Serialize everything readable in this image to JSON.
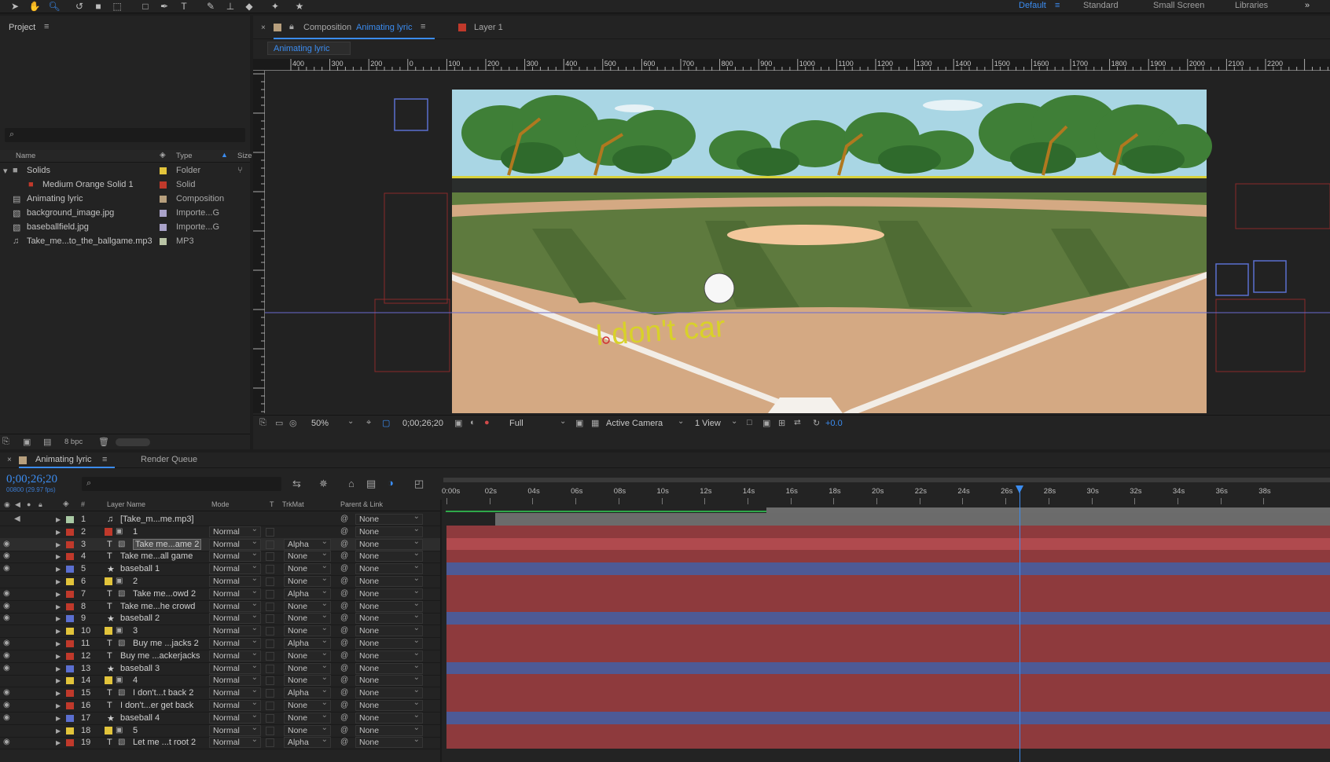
{
  "toolbar": {
    "tools": [
      "selection-tool",
      "hand-tool",
      "zoom-tool",
      "rotate-tool",
      "camera-tool",
      "pan-behind-tool",
      "rectangle-tool",
      "pen-tool",
      "type-tool",
      "brush-tool",
      "clone-stamp-tool",
      "eraser-tool",
      "roto-brush-tool",
      "puppet-tool"
    ],
    "workspaces": [
      "Default",
      "Standard",
      "Small Screen",
      "Libraries"
    ],
    "active_workspace": "Default",
    "more": "»"
  },
  "project": {
    "title": "Project",
    "search_icon": "search-icon",
    "columns": {
      "name": "Name",
      "type": "Type",
      "size": "Size"
    },
    "items": [
      {
        "name": "Solids",
        "type": "Folder",
        "label_color": "#e2c43b",
        "icon": "folder-icon"
      },
      {
        "name": "Medium Orange Solid 1",
        "type": "Solid",
        "label_color": "#c0392b",
        "icon": "solid-icon"
      },
      {
        "name": "Animating lyric",
        "type": "Composition",
        "label_color": "#b79f7d",
        "icon": "composition-icon"
      },
      {
        "name": "background_image.jpg",
        "type": "Importe...G",
        "label_color": "#a9a2c9",
        "icon": "image-file-icon"
      },
      {
        "name": "baseballfield.jpg",
        "type": "Importe...G",
        "label_color": "#a9a2c9",
        "icon": "image-file-icon"
      },
      {
        "name": "Take_me...to_the_ballgame.mp3",
        "type": "MP3",
        "label_color": "#b9c4a5",
        "icon": "audio-file-icon"
      }
    ],
    "footer": {
      "bpc": "8 bpc"
    }
  },
  "comp_panel": {
    "tab_prefix": "Composition",
    "tab_name": "Animating lyric",
    "layer_tab": "Layer 1",
    "breadcrumb": "Animating lyric",
    "ruler_labels": [
      "400",
      "300",
      "200",
      "0",
      "100",
      "200",
      "300",
      "400",
      "500",
      "600",
      "700",
      "800",
      "900",
      "1000",
      "1100",
      "1200",
      "1300",
      "1400",
      "1500",
      "1600",
      "1700",
      "1800",
      "1900",
      "2000",
      "2100",
      "2200"
    ],
    "lyric_text": "I don't car",
    "footer": {
      "zoom": "50%",
      "timecode": "0;00;26;20",
      "resolution": "Full",
      "camera": "Active Camera",
      "views": "1 View",
      "exposure": "+0.0"
    }
  },
  "timeline": {
    "tab": "Animating lyric",
    "render_queue": "Render Queue",
    "timecode": "0;00;26;20",
    "frames": "00800 (29.97 fps)",
    "columns": {
      "num": "#",
      "layer_name": "Layer Name",
      "mode": "Mode",
      "t": "T",
      "trkmat": "TrkMat",
      "parent": "Parent & Link"
    },
    "time_labels": [
      "0:00s",
      "02s",
      "04s",
      "06s",
      "08s",
      "10s",
      "12s",
      "14s",
      "16s",
      "18s",
      "20s",
      "22s",
      "24s",
      "26s",
      "28s",
      "30s",
      "32s",
      "34s",
      "36s",
      "38s"
    ],
    "playhead_seconds": 26.67,
    "layers": [
      {
        "num": "1",
        "name": "[Take_m...me.mp3]",
        "kind": "audio",
        "color": "#a9c9a4",
        "mode": "",
        "trkmat": "",
        "parent": "None",
        "eye": false,
        "bar": "#6b6b6b"
      },
      {
        "num": "2",
        "name": "1",
        "kind": "solid",
        "color": "#c0392b",
        "mode": "Normal",
        "trkmat": "",
        "parent": "None",
        "eye": false,
        "bar": "#8e3a3d"
      },
      {
        "num": "3",
        "name": "Take me...ame 2",
        "kind": "text-matte",
        "color": "#c0392b",
        "mode": "Normal",
        "trkmat": "Alpha",
        "parent": "None",
        "eye": true,
        "bar": "#b04a4e",
        "selected": true
      },
      {
        "num": "4",
        "name": "Take me...all game",
        "kind": "text",
        "color": "#c0392b",
        "mode": "Normal",
        "trkmat": "None",
        "parent": "None",
        "eye": true,
        "bar": "#8e3a3d"
      },
      {
        "num": "5",
        "name": "baseball 1",
        "kind": "shape",
        "color": "#5b6fd0",
        "mode": "Normal",
        "trkmat": "None",
        "parent": "None",
        "eye": true,
        "bar": "#4d5a96"
      },
      {
        "num": "6",
        "name": "2",
        "kind": "solid",
        "color": "#e2c43b",
        "mode": "Normal",
        "trkmat": "None",
        "parent": "None",
        "eye": false,
        "bar": "#8e3a3d"
      },
      {
        "num": "7",
        "name": "Take me...owd 2",
        "kind": "text-matte",
        "color": "#c0392b",
        "mode": "Normal",
        "trkmat": "Alpha",
        "parent": "None",
        "eye": true,
        "bar": "#8e3a3d"
      },
      {
        "num": "8",
        "name": "Take me...he crowd",
        "kind": "text",
        "color": "#c0392b",
        "mode": "Normal",
        "trkmat": "None",
        "parent": "None",
        "eye": true,
        "bar": "#8e3a3d"
      },
      {
        "num": "9",
        "name": "baseball 2",
        "kind": "shape",
        "color": "#5b6fd0",
        "mode": "Normal",
        "trkmat": "None",
        "parent": "None",
        "eye": true,
        "bar": "#4d5a96"
      },
      {
        "num": "10",
        "name": "3",
        "kind": "solid",
        "color": "#e2c43b",
        "mode": "Normal",
        "trkmat": "None",
        "parent": "None",
        "eye": false,
        "bar": "#8e3a3d"
      },
      {
        "num": "11",
        "name": "Buy me ...jacks 2",
        "kind": "text-matte",
        "color": "#c0392b",
        "mode": "Normal",
        "trkmat": "Alpha",
        "parent": "None",
        "eye": true,
        "bar": "#8e3a3d"
      },
      {
        "num": "12",
        "name": "Buy me ...ackerjacks",
        "kind": "text",
        "color": "#c0392b",
        "mode": "Normal",
        "trkmat": "None",
        "parent": "None",
        "eye": true,
        "bar": "#8e3a3d"
      },
      {
        "num": "13",
        "name": "baseball 3",
        "kind": "shape",
        "color": "#5b6fd0",
        "mode": "Normal",
        "trkmat": "None",
        "parent": "None",
        "eye": true,
        "bar": "#4d5a96"
      },
      {
        "num": "14",
        "name": "4",
        "kind": "solid",
        "color": "#e2c43b",
        "mode": "Normal",
        "trkmat": "None",
        "parent": "None",
        "eye": false,
        "bar": "#8e3a3d"
      },
      {
        "num": "15",
        "name": "I don't...t back 2",
        "kind": "text-matte",
        "color": "#c0392b",
        "mode": "Normal",
        "trkmat": "Alpha",
        "parent": "None",
        "eye": true,
        "bar": "#8e3a3d"
      },
      {
        "num": "16",
        "name": "I don't...er get back",
        "kind": "text",
        "color": "#c0392b",
        "mode": "Normal",
        "trkmat": "None",
        "parent": "None",
        "eye": true,
        "bar": "#8e3a3d"
      },
      {
        "num": "17",
        "name": "baseball 4",
        "kind": "shape",
        "color": "#5b6fd0",
        "mode": "Normal",
        "trkmat": "None",
        "parent": "None",
        "eye": true,
        "bar": "#4d5a96"
      },
      {
        "num": "18",
        "name": "5",
        "kind": "solid",
        "color": "#e2c43b",
        "mode": "Normal",
        "trkmat": "None",
        "parent": "None",
        "eye": false,
        "bar": "#8e3a3d"
      },
      {
        "num": "19",
        "name": "Let me ...t root 2",
        "kind": "text-matte",
        "color": "#c0392b",
        "mode": "Normal",
        "trkmat": "Alpha",
        "parent": "None",
        "eye": true,
        "bar": "#8e3a3d"
      }
    ]
  }
}
